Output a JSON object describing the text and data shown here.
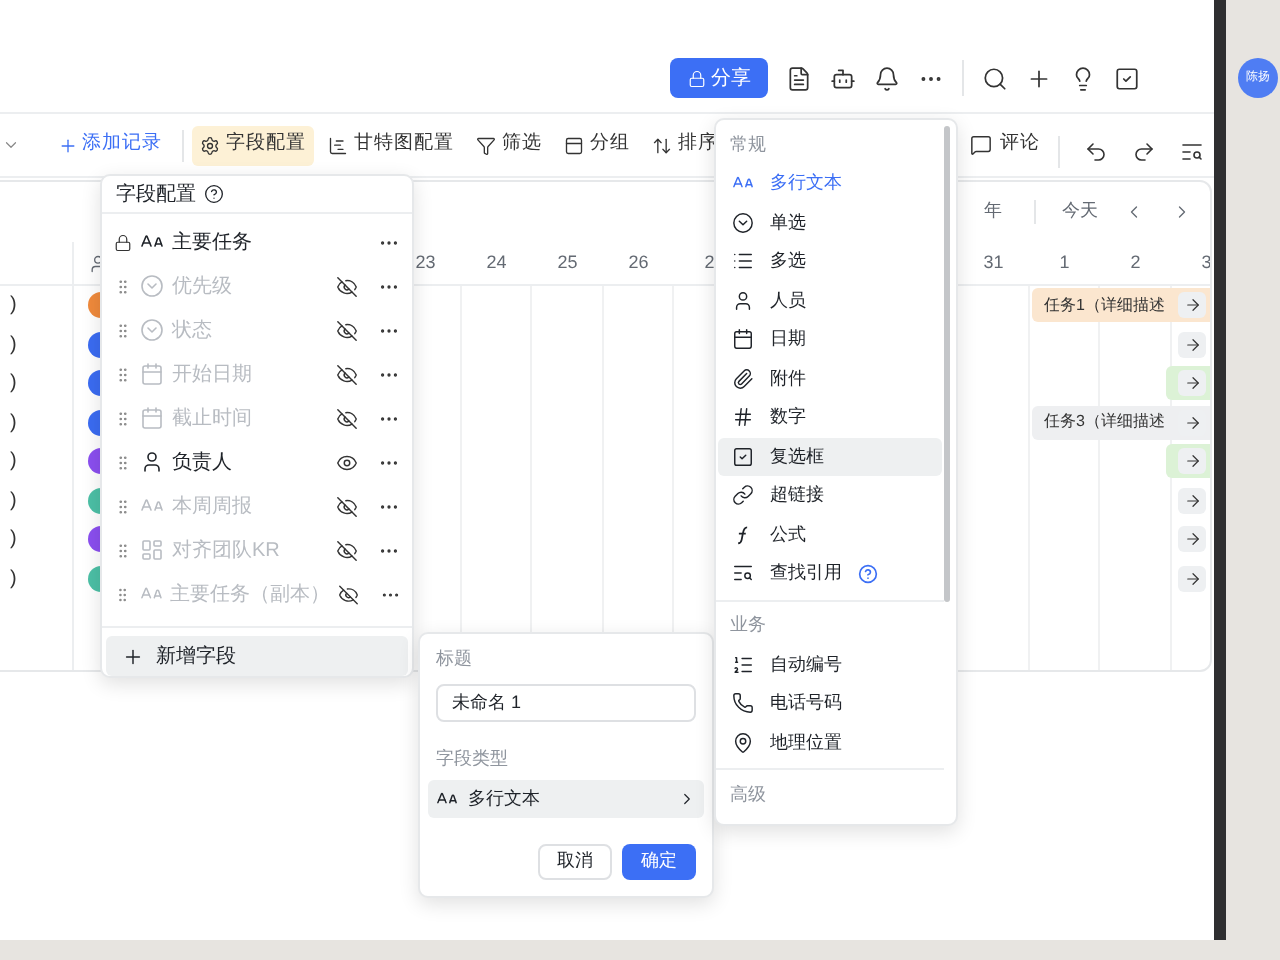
{
  "top_bar": {
    "share_button": "分享",
    "avatar": "陈扬"
  },
  "toolbar": {
    "add_record": "添加记录",
    "items": [
      {
        "label": "字段配置",
        "selected": true
      },
      {
        "label": "甘特图配置",
        "selected": false
      },
      {
        "label": "筛选",
        "selected": false
      },
      {
        "label": "分组",
        "selected": false
      },
      {
        "label": "排序",
        "selected": false
      }
    ],
    "comment": "评论"
  },
  "gantt": {
    "scale": "年",
    "today": "今天",
    "dates_before": [
      "23",
      "24",
      "25",
      "26",
      "2"
    ],
    "dates_after": [
      "31",
      "1",
      "2",
      "3"
    ],
    "rows": [
      {
        "title": ")",
        "avatar": {
          "color": "#f08a3c"
        },
        "kind": "bar",
        "label": "任务1（详细描述",
        "color": "#fbe6cf"
      },
      {
        "title": ")",
        "avatar": {
          "color": "#3b6cf2"
        },
        "kind": "jump"
      },
      {
        "title": ")",
        "avatar": {
          "color": "#3b6cf2"
        },
        "kind": "short_bar",
        "color": "#dcf2d6"
      },
      {
        "title": ")",
        "avatar": {
          "color": "#3b6cf2"
        },
        "kind": "bar",
        "label": "任务3（详细描述",
        "color": "#eeeff1"
      },
      {
        "title": ")",
        "avatar": {
          "color": "#8b4ff0"
        },
        "kind": "short_bar",
        "color": "#dcf2d6"
      },
      {
        "title": ")",
        "avatar": {
          "color": "#4cc0a6"
        },
        "kind": "jump"
      },
      {
        "title": ")",
        "avatar": {
          "color": "#8b4ff0"
        },
        "kind": "jump"
      },
      {
        "title": ")",
        "avatar": {
          "color": "#4cc0a6"
        },
        "kind": "jump"
      }
    ]
  },
  "field_config": {
    "title": "字段配置",
    "fields": [
      {
        "name": "主要任务",
        "kind": "text",
        "locked": true,
        "visible": true
      },
      {
        "name": "优先级",
        "kind": "select",
        "locked": false,
        "visible": false
      },
      {
        "name": "状态",
        "kind": "select",
        "locked": false,
        "visible": false
      },
      {
        "name": "开始日期",
        "kind": "date",
        "locked": false,
        "visible": false
      },
      {
        "name": "截止时间",
        "kind": "date",
        "locked": false,
        "visible": false
      },
      {
        "name": "负责人",
        "kind": "person",
        "locked": false,
        "visible": true
      },
      {
        "name": "本周周报",
        "kind": "text",
        "locked": false,
        "visible": false
      },
      {
        "name": "对齐团队KR",
        "kind": "grid",
        "locked": false,
        "visible": false
      },
      {
        "name": "主要任务（副本）",
        "kind": "text",
        "locked": false,
        "visible": false
      }
    ],
    "add_button": "新增字段"
  },
  "new_field_form": {
    "title_label": "标题",
    "title_value": "未命名 1",
    "type_label": "字段类型",
    "type_value": "多行文本",
    "cancel_button": "取消",
    "confirm_button": "确定"
  },
  "type_menu": {
    "sections": [
      {
        "title": "常规",
        "items": [
          {
            "label": "多行文本",
            "kind": "text",
            "selected": true,
            "hovered": false,
            "help": false
          },
          {
            "label": "单选",
            "kind": "select",
            "selected": false,
            "hovered": false,
            "help": false
          },
          {
            "label": "多选",
            "kind": "list",
            "selected": false,
            "hovered": false,
            "help": false
          },
          {
            "label": "人员",
            "kind": "person",
            "selected": false,
            "hovered": false,
            "help": false
          },
          {
            "label": "日期",
            "kind": "date",
            "selected": false,
            "hovered": false,
            "help": false
          },
          {
            "label": "附件",
            "kind": "attach",
            "selected": false,
            "hovered": false,
            "help": false
          },
          {
            "label": "数字",
            "kind": "hash",
            "selected": false,
            "hovered": false,
            "help": false
          },
          {
            "label": "复选框",
            "kind": "check",
            "selected": false,
            "hovered": true,
            "help": false
          },
          {
            "label": "超链接",
            "kind": "link",
            "selected": false,
            "hovered": false,
            "help": false
          },
          {
            "label": "公式",
            "kind": "formula",
            "selected": false,
            "hovered": false,
            "help": false
          },
          {
            "label": "查找引用",
            "kind": "lookup",
            "selected": false,
            "hovered": false,
            "help": true
          }
        ]
      },
      {
        "title": "业务",
        "items": [
          {
            "label": "自动编号",
            "kind": "ordered",
            "selected": false,
            "hovered": false,
            "help": false
          },
          {
            "label": "电话号码",
            "kind": "phone",
            "selected": false,
            "hovered": false,
            "help": false
          },
          {
            "label": "地理位置",
            "kind": "pin",
            "selected": false,
            "hovered": false,
            "help": false
          }
        ]
      },
      {
        "title": "高级"
      }
    ]
  }
}
